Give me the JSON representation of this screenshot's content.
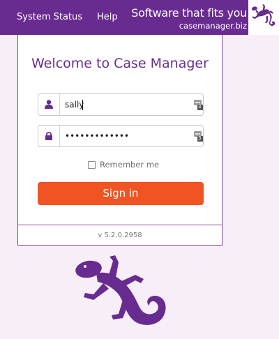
{
  "header": {
    "nav": [
      "System Status",
      "Help"
    ],
    "tagline": "Software that fits you",
    "domain": "casemanager.biz"
  },
  "login": {
    "title": "Welcome to Case Manager",
    "username": {
      "value": "sally",
      "icon": "user-icon"
    },
    "password": {
      "value": "•••••••••••••",
      "icon": "lock-icon"
    },
    "key_badge_text": "3",
    "remember_label": "Remember me",
    "remember_checked": false,
    "submit_label": "Sign in"
  },
  "footer": {
    "version": "v 5.2.0.2958"
  },
  "colors": {
    "brand_purple": "#682b90",
    "accent_orange": "#f05423",
    "page_background": "#f7eef8"
  }
}
